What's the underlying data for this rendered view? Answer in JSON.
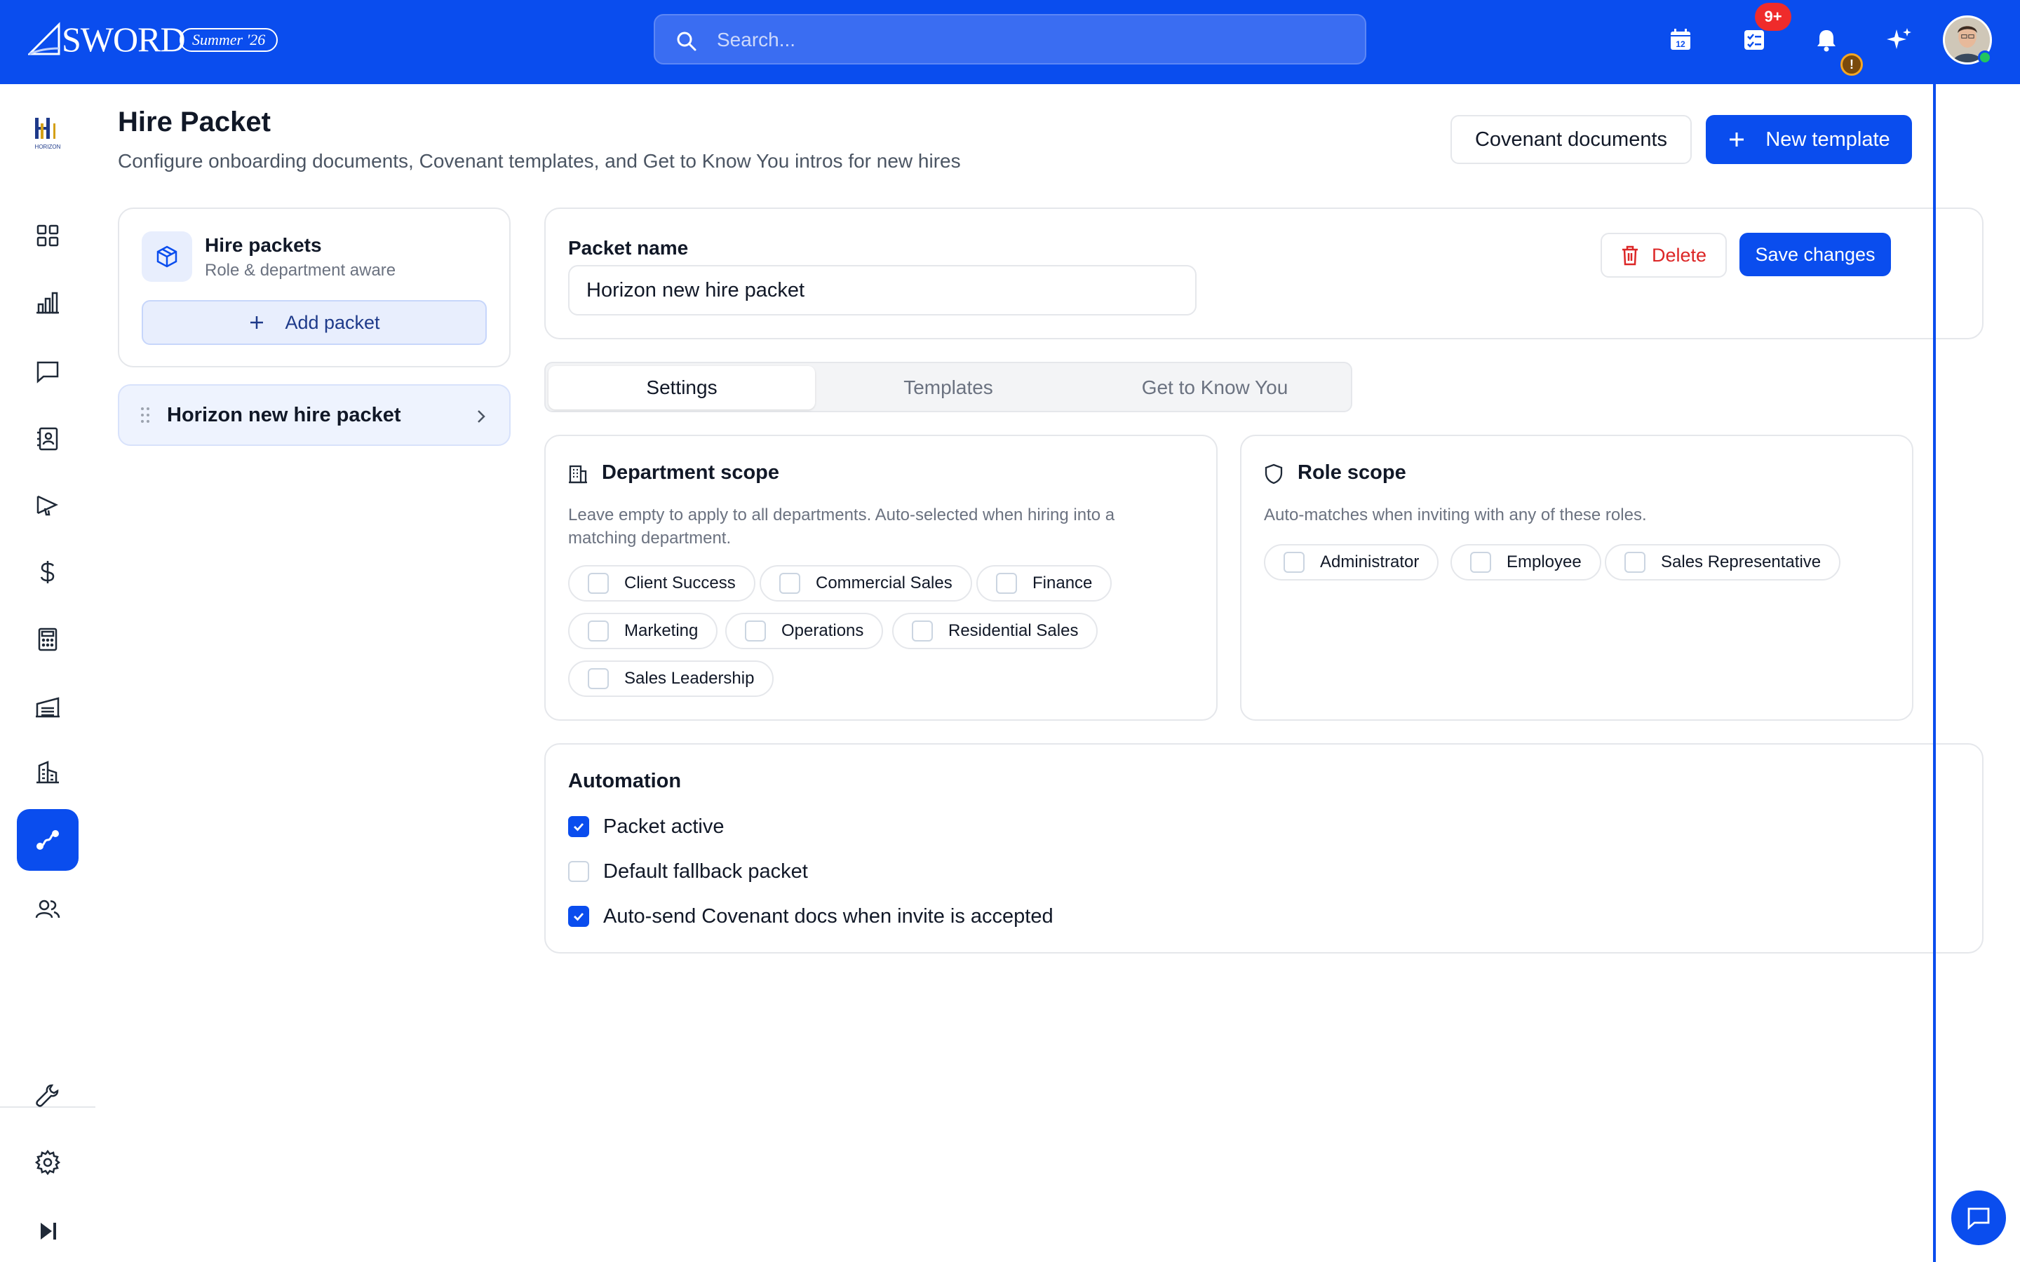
{
  "topbar": {
    "brand": "SWORD",
    "season": "Summer '26",
    "search_placeholder": "Search...",
    "tasks_badge": "9+",
    "notification_badge": "!",
    "icons": [
      "calendar-icon",
      "tasks-icon",
      "bell-icon",
      "sparkle-icon"
    ]
  },
  "leftnav": {
    "org_logo": "HORIZON",
    "items": [
      "dashboard-icon",
      "analytics-icon",
      "messages-icon",
      "contacts-icon",
      "campaigns-icon",
      "finance-icon",
      "calculator-icon",
      "warehouse-icon",
      "buildings-icon",
      "workflow-icon",
      "team-icon"
    ],
    "active": "workflow-icon",
    "bottom_items": [
      "tools-icon",
      "settings-icon",
      "collapse-icon"
    ]
  },
  "header": {
    "title": "Hire Packet",
    "subtitle": "Configure onboarding documents, Covenant templates, and Get to Know You intros for new hires",
    "covenant_button": "Covenant documents",
    "new_template_button": "New template"
  },
  "packets": {
    "title": "Hire packets",
    "subtitle": "Role & department aware",
    "add_button": "Add packet",
    "items": [
      {
        "label": "Horizon new hire packet"
      }
    ]
  },
  "editor": {
    "name_label": "Packet name",
    "name_value": "Horizon new hire packet",
    "delete_button": "Delete",
    "save_button": "Save changes",
    "tabs": [
      {
        "label": "Settings",
        "active": true
      },
      {
        "label": "Templates",
        "active": false
      },
      {
        "label": "Get to Know You",
        "active": false
      }
    ]
  },
  "department_scope": {
    "title": "Department scope",
    "description": "Leave empty to apply to all departments. Auto-selected when hiring into a matching department.",
    "options": [
      "Client Success",
      "Commercial Sales",
      "Finance",
      "Marketing",
      "Operations",
      "Residential Sales",
      "Sales Leadership"
    ]
  },
  "role_scope": {
    "title": "Role scope",
    "description": "Auto-matches when inviting with any of these roles.",
    "options": [
      "Administrator",
      "Employee",
      "Sales Representative"
    ]
  },
  "automation": {
    "title": "Automation",
    "options": [
      {
        "label": "Packet active",
        "checked": true
      },
      {
        "label": "Default fallback packet",
        "checked": false
      },
      {
        "label": "Auto-send Covenant docs when invite is accepted",
        "checked": true
      }
    ]
  },
  "colors": {
    "primary": "#0a4dee",
    "danger": "#dc2626",
    "badge": "#ef2b2b",
    "success": "#22c55e"
  }
}
